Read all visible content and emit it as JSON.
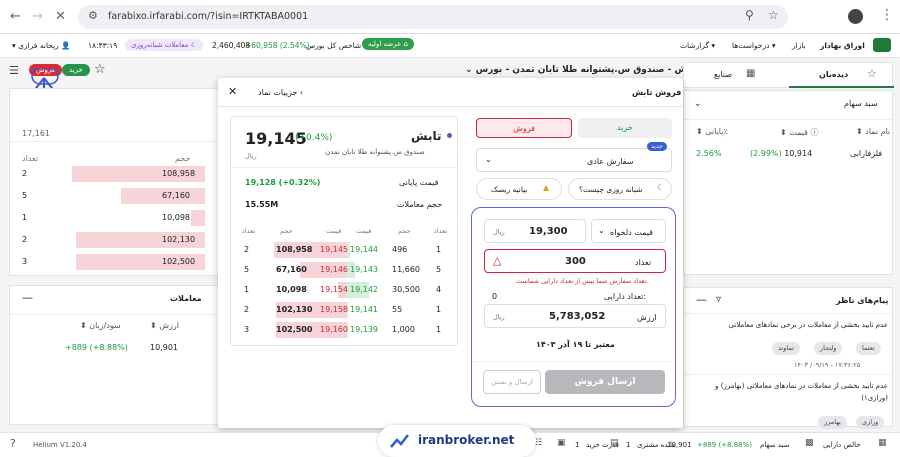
{
  "browser": {
    "url": "farabixo.irfarabi.com/?isin=IRTKTABA0001"
  },
  "header": {
    "app_name": "اوراق بهادار",
    "menus": [
      "بازار",
      "درخواست‌ها",
      "گزارشات"
    ],
    "ipo_label": "عرضه اولیه",
    "index_label": "شاخص کل بورس",
    "index_change": "+60,958 (2.54%)",
    "index_value": "2,460,408",
    "overnight_label": "معاملات شبانه‌روزی",
    "clock": "۱۸:۴۳:۱۹",
    "user_name": "ریحانه فرازی"
  },
  "symbol_bar": {
    "title": "تابش - صندوق س.پشتوانه طلا تابان تمدن - بورس",
    "sell_label": "فروش",
    "buy_label": "خرید"
  },
  "watch_tabs": {
    "watchlist": "دیده‌بان",
    "industry": "صنایع"
  },
  "portfolio": {
    "select_label": "سبد سهام",
    "col_symbol": "نام نماد",
    "col_price": "قیمت",
    "col_close": "پایانی٪",
    "row": {
      "symbol": "فلزفارابی",
      "price": "10,914",
      "price_change": "(2.99%)",
      "close_pct": "2.56%"
    }
  },
  "messages": {
    "title": "پیام‌های ناظر",
    "items": [
      {
        "text": "عدم تایید بخشی از معاملات در برخی نمادهای معاملاتی",
        "tags": [
          "تعتما",
          "ولتجار",
          "تماوند"
        ],
        "time": "۱۴۰۳ /۰۹/۱۹ - ۱۷:۳۶:۲۵"
      },
      {
        "text": "عدم تایید بخشی از معاملات در نمادهای معاملاتی (بهامرز) و (ورازی۱)",
        "tags": [
          "ورازی",
          "بهامرز"
        ]
      }
    ]
  },
  "order": {
    "title": "فروش تابش",
    "buy_tab": "خرید",
    "sell_tab": "فروش",
    "new_badge": "جدید",
    "order_type": "سفارش عادی",
    "overnight_link": "شبانه روزی چیست؟",
    "risk_label": "بیانیه ریسک",
    "price_mode": "قیمت دلخواه",
    "price": "19,300",
    "currency": "ریال",
    "qty_label": "تعداد",
    "qty": "300",
    "warning": "تعداد سفارش شما بیش از تعداد دارایی شماست.",
    "asset_label": "تعداد دارایی:",
    "asset_value": "0",
    "value_label": "ارزش",
    "value": "5,783,052",
    "valid_until": "معتبر تا ۱۹ آذر ۱۴۰۳",
    "submit_sell": "ارسال فروش",
    "submit_close": "ارسال و بستن"
  },
  "details": {
    "title": "جزییات نماد",
    "symbol": "تابش",
    "full_name": "صندوق س.پشتوانه طلا تابان تمدن",
    "price": "19,145",
    "change": "(+0.4%)",
    "currency": "ریال",
    "close_label": "قیمت پایانی",
    "close_value": "19,128 (+0.32%)",
    "volume_label": "حجم معاملات",
    "volume_value": "15.55M",
    "book_headers": [
      "تعداد",
      "حجم",
      "قیمت",
      "قیمت",
      "حجم",
      "تعداد"
    ],
    "book": [
      {
        "sell_count": "2",
        "sell_vol": "108,958",
        "sell_price": "19,145",
        "buy_price": "19,144",
        "buy_vol": "496",
        "buy_count": "1",
        "sell_fill": 0.95,
        "buy_fill": 0.05
      },
      {
        "sell_count": "5",
        "sell_vol": "67,160",
        "sell_price": "19,146",
        "buy_price": "19,143",
        "buy_vol": "11,660",
        "buy_count": "5",
        "sell_fill": 0.6,
        "buy_fill": 0.12
      },
      {
        "sell_count": "1",
        "sell_vol": "10,098",
        "sell_price": "19,154",
        "buy_price": "19,142",
        "buy_vol": "30,500",
        "buy_count": "4",
        "sell_fill": 0.1,
        "buy_fill": 0.3
      },
      {
        "sell_count": "2",
        "sell_vol": "102,130",
        "sell_price": "19,158",
        "buy_price": "19,141",
        "buy_vol": "55",
        "buy_count": "1",
        "sell_fill": 0.92,
        "buy_fill": 0.02
      },
      {
        "sell_count": "3",
        "sell_vol": "102,500",
        "sell_price": "19,160",
        "buy_price": "19,139",
        "buy_vol": "1,000",
        "buy_count": "1",
        "sell_fill": 0.92,
        "buy_fill": 0.03
      }
    ]
  },
  "left_book": {
    "count_header": "تعداد",
    "volume_header": "حجم",
    "top_value": "17,161",
    "rows": [
      {
        "count": "2",
        "volume": "108,958",
        "fill": 0.95
      },
      {
        "count": "5",
        "volume": "67,160",
        "fill": 0.6
      },
      {
        "count": "1",
        "volume": "10,098",
        "fill": 0.1
      },
      {
        "count": "2",
        "volume": "102,130",
        "fill": 0.92
      },
      {
        "count": "3",
        "volume": "102,500",
        "fill": 0.92
      }
    ]
  },
  "trades": {
    "title": "معاملات",
    "col_pl": "سود/زیان",
    "col_value": "ارزش",
    "pl": "+889 (+8.88%)",
    "value": "10,901"
  },
  "status": {
    "version": "Helium V1.20.4",
    "buy_power_label": "قدرت خرید",
    "buy_power_value": "1",
    "remaining_label": "مانده مشتری",
    "remaining_value": "1",
    "value": "10,901",
    "portfolio_label": "سبد سهام",
    "portfolio_pl": "+889 (+8.88%)",
    "net_label": "خالص دارایی"
  },
  "watermark": {
    "text": "iranbroker.net"
  }
}
